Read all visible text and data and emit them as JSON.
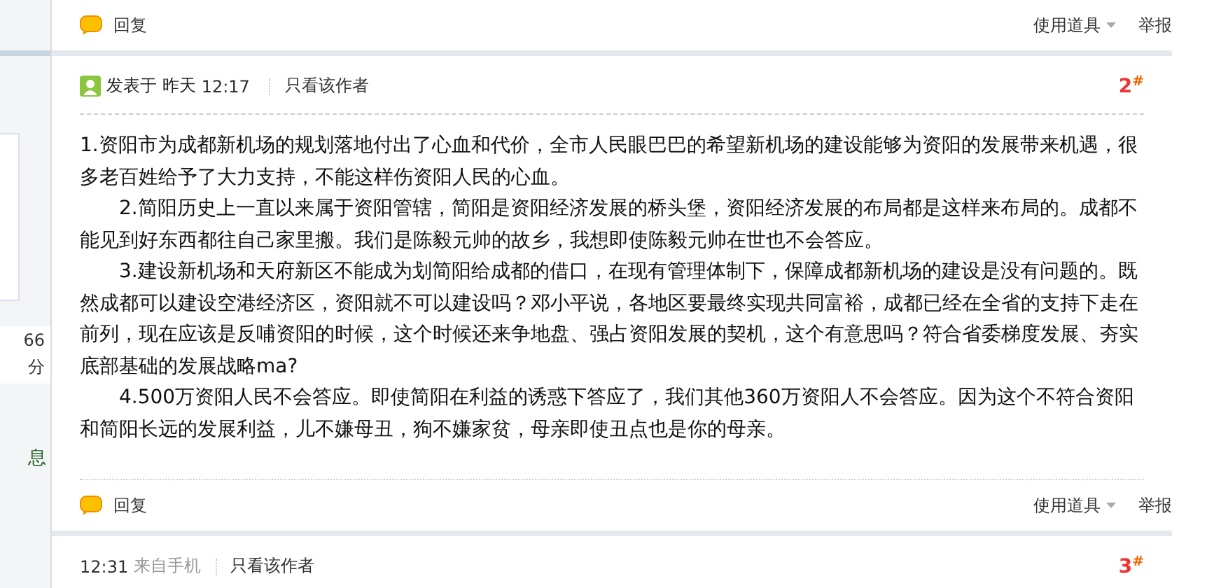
{
  "sidebar": {
    "stats": [
      "66",
      "分"
    ],
    "link": "息"
  },
  "top_actions": {
    "reply": "回复",
    "tools": "使用道具",
    "report": "举报"
  },
  "posts": [
    {
      "avatar": true,
      "posted": "发表于 昨天",
      "time": "12:17",
      "only_author": "只看该作者",
      "floor": "2",
      "floor_mark": "#",
      "paragraphs": [
        {
          "text": "1.资阳市为成都新机场的规划落地付出了心血和代价，全市人民眼巴巴的希望新机场的建设能够为资阳的发展带来机遇，很多老百姓给予了大力支持，不能这样伤资阳人民的心血。",
          "indented": false
        },
        {
          "text": "2.简阳历史上一直以来属于资阳管辖，简阳是资阳经济发展的桥头堡，资阳经济发展的布局都是这样来布局的。成都不能见到好东西都往自己家里搬。我们是陈毅元帅的故乡，我想即使陈毅元帅在世也不会答应。",
          "indented": true
        },
        {
          "text": "3.建设新机场和天府新区不能成为划简阳给成都的借口，在现有管理体制下，保障成都新机场的建设是没有问题的。既然成都可以建设空港经济区，资阳就不可以建设吗？邓小平说，各地区要最终实现共同富裕，成都已经在全省的支持下走在前列，现在应该是反哺资阳的时候，这个时候还来争地盘、强占资阳发展的契机，这个有意思吗？符合省委梯度发展、夯实底部基础的发展战略ma?",
          "indented": true
        },
        {
          "text": "4.500万资阳人民不会答应。即使简阳在利益的诱惑下答应了，我们其他360万资阳人不会答应。因为这个不符合资阳和简阳长远的发展利益，儿不嫌母丑，狗不嫌家贫，母亲即使丑点也是你的母亲。",
          "indented": true
        }
      ],
      "actions": {
        "reply": "回复",
        "tools": "使用道具",
        "report": "举报"
      }
    },
    {
      "avatar": false,
      "time": "12:31",
      "source": "来自手机",
      "only_author": "只看该作者",
      "floor": "3",
      "floor_mark": "#"
    }
  ]
}
